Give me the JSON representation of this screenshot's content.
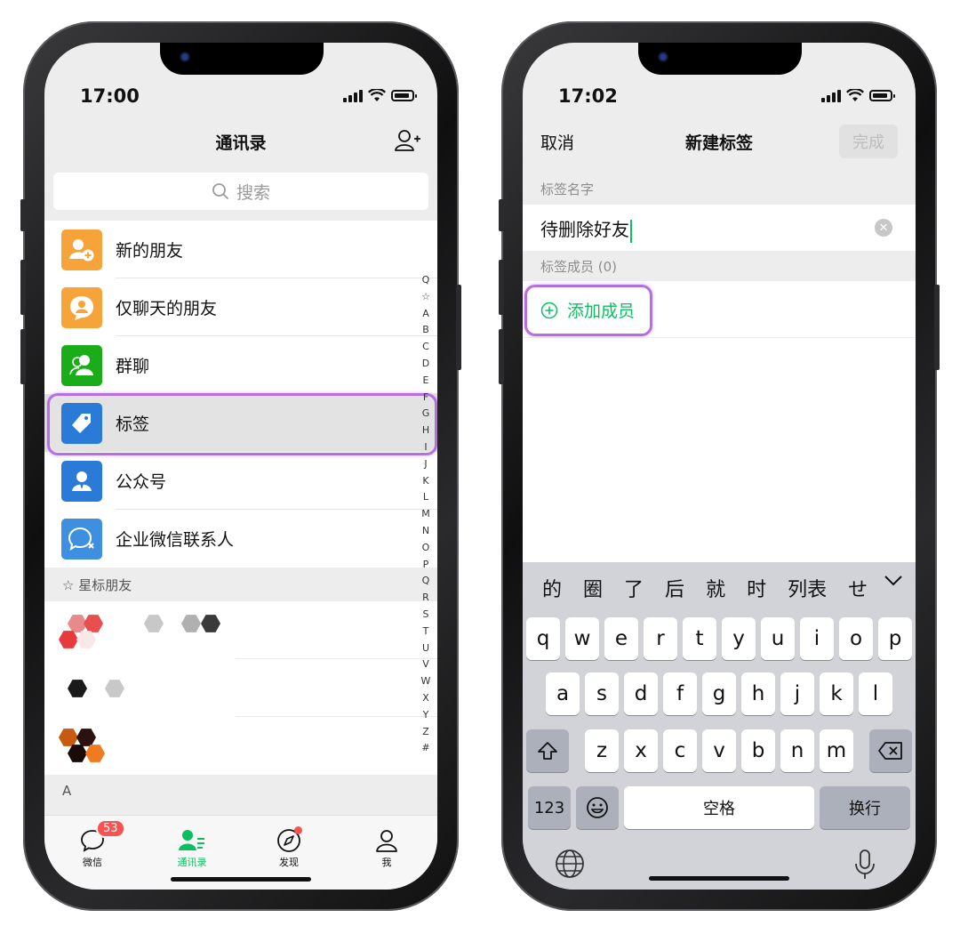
{
  "left": {
    "status_time": "17:00",
    "nav_title": "通讯录",
    "search_placeholder": "搜索",
    "items": [
      {
        "label": "新的朋友",
        "color": "#f6a43a"
      },
      {
        "label": "仅聊天的朋友",
        "color": "#f6a43a"
      },
      {
        "label": "群聊",
        "color": "#1aad19"
      },
      {
        "label": "标签",
        "color": "#2a7ad8"
      },
      {
        "label": "公众号",
        "color": "#2a7ad8"
      },
      {
        "label": "企业微信联系人",
        "color": "#3e8fe0"
      }
    ],
    "starred_header": "☆ 星标朋友",
    "section_a": "A",
    "index_letters": [
      "Q",
      "☆",
      "A",
      "B",
      "C",
      "D",
      "E",
      "F",
      "G",
      "H",
      "I",
      "J",
      "K",
      "L",
      "M",
      "N",
      "O",
      "P",
      "Q",
      "R",
      "S",
      "T",
      "U",
      "V",
      "W",
      "X",
      "Y",
      "Z",
      "#"
    ],
    "tabs": [
      {
        "label": "微信",
        "badge": "53"
      },
      {
        "label": "通讯录"
      },
      {
        "label": "发现"
      },
      {
        "label": "我"
      }
    ],
    "accent": "#07c160"
  },
  "right": {
    "status_time": "17:02",
    "cancel": "取消",
    "nav_title": "新建标签",
    "done": "完成",
    "name_label": "标签名字",
    "name_value": "待删除好友",
    "members_label": "标签成员 (0)",
    "add_member": "添加成员",
    "candidates": [
      "的",
      "圈",
      "了",
      "后",
      "就",
      "时",
      "列表",
      "せ"
    ],
    "keys_row1": [
      "q",
      "w",
      "e",
      "r",
      "t",
      "y",
      "u",
      "i",
      "o",
      "p"
    ],
    "keys_row2": [
      "a",
      "s",
      "d",
      "f",
      "g",
      "h",
      "j",
      "k",
      "l"
    ],
    "keys_row3": [
      "z",
      "x",
      "c",
      "v",
      "b",
      "n",
      "m"
    ],
    "key_123": "123",
    "key_space": "空格",
    "key_return": "换行"
  },
  "highlight_color": "#b56fe0"
}
